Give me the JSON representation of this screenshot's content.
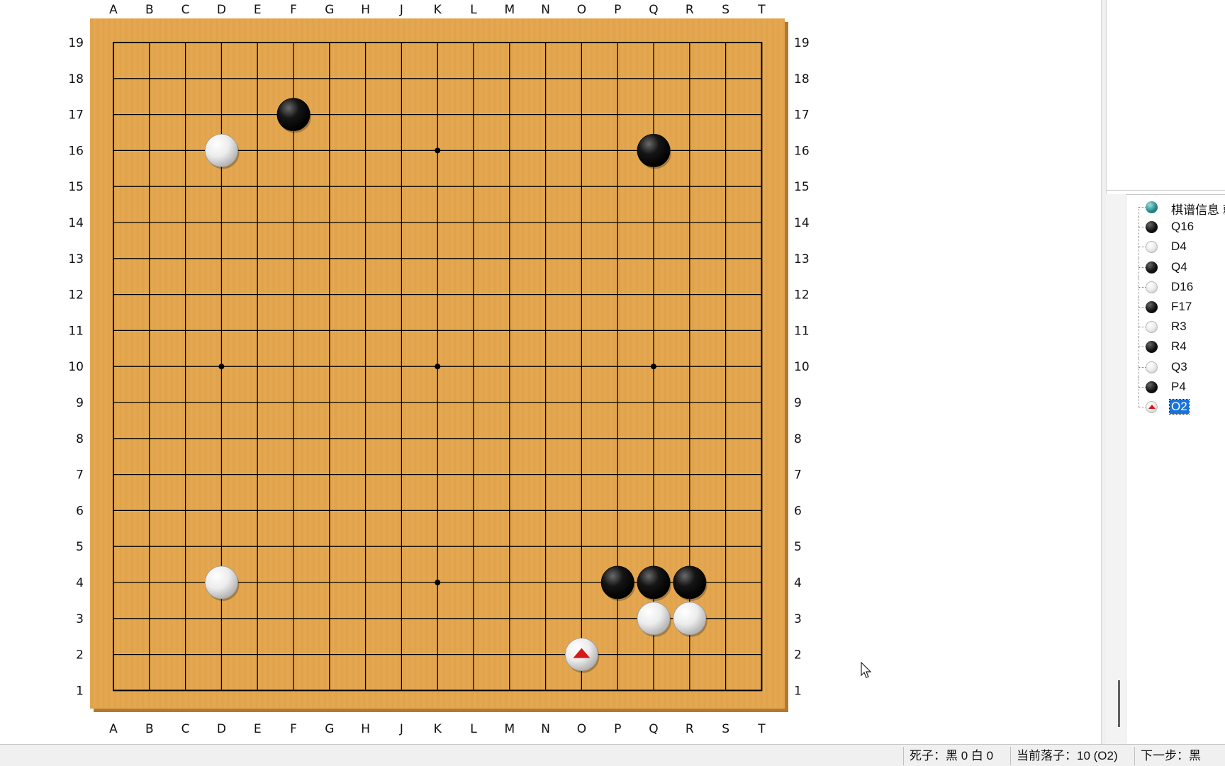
{
  "board": {
    "size": 19,
    "columns": [
      "A",
      "B",
      "C",
      "D",
      "E",
      "F",
      "G",
      "H",
      "J",
      "K",
      "L",
      "M",
      "N",
      "O",
      "P",
      "Q",
      "R",
      "S",
      "T"
    ],
    "rows": [
      "19",
      "18",
      "17",
      "16",
      "15",
      "14",
      "13",
      "12",
      "11",
      "10",
      "9",
      "8",
      "7",
      "6",
      "5",
      "4",
      "3",
      "2",
      "1"
    ],
    "star_points": [
      "D16",
      "K16",
      "Q16",
      "D10",
      "K10",
      "Q10",
      "D4",
      "K4",
      "Q4"
    ],
    "stones": [
      {
        "point": "Q16",
        "color": "black"
      },
      {
        "point": "D4",
        "color": "white"
      },
      {
        "point": "Q4",
        "color": "black"
      },
      {
        "point": "D16",
        "color": "white"
      },
      {
        "point": "F17",
        "color": "black"
      },
      {
        "point": "R3",
        "color": "white"
      },
      {
        "point": "R4",
        "color": "black"
      },
      {
        "point": "Q3",
        "color": "white"
      },
      {
        "point": "P4",
        "color": "black"
      },
      {
        "point": "O2",
        "color": "white",
        "marker": "triangle"
      }
    ],
    "board_color": "#e3a64f",
    "line_color": "#000000",
    "marker_color": "#d61818"
  },
  "game_tree": {
    "items": [
      {
        "label": "棋谱信息 就",
        "type": "info"
      },
      {
        "label": "Q16",
        "type": "black"
      },
      {
        "label": "D4",
        "type": "white"
      },
      {
        "label": "Q4",
        "type": "black"
      },
      {
        "label": "D16",
        "type": "white"
      },
      {
        "label": "F17",
        "type": "black"
      },
      {
        "label": "R3",
        "type": "white"
      },
      {
        "label": "R4",
        "type": "black"
      },
      {
        "label": "Q3",
        "type": "white"
      },
      {
        "label": "P4",
        "type": "black"
      },
      {
        "label": "O2",
        "type": "current"
      }
    ]
  },
  "status_bar": {
    "captured": "死子：黑 0 白 0",
    "current_move": "当前落子：10 (O2)",
    "next_move": "下一步：黑"
  },
  "icons": {
    "cursor": "mouse-pointer-icon",
    "stone_marker": "triangle-marker-icon"
  }
}
